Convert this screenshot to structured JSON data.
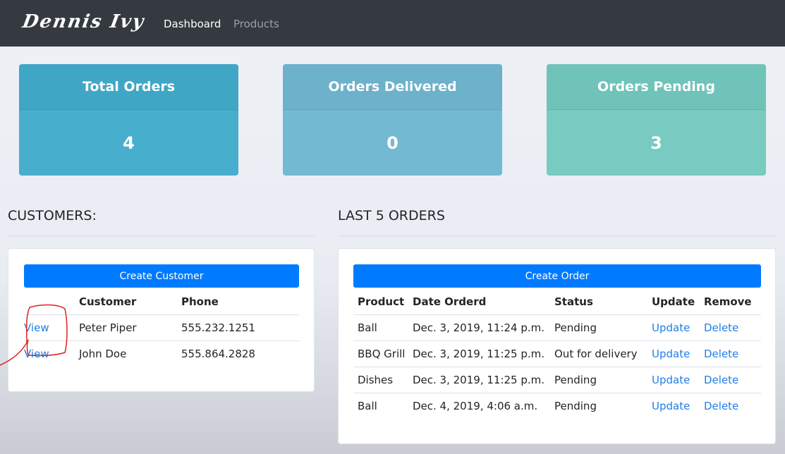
{
  "navbar": {
    "brand": "Dennis Ivy",
    "links": [
      "Dashboard",
      "Products"
    ]
  },
  "stats": [
    {
      "title": "Total Orders",
      "value": "4",
      "color": "#48aece"
    },
    {
      "title": "Orders Delivered",
      "value": "0",
      "color": "#74b9d2"
    },
    {
      "title": "Orders Pending",
      "value": "3",
      "color": "#79cac0"
    }
  ],
  "customers": {
    "section_title": "CUSTOMERS:",
    "create_label": "Create Customer",
    "headers": [
      "",
      "Customer",
      "Phone"
    ],
    "rows": [
      {
        "action": "View",
        "name": "Peter Piper",
        "phone": "555.232.1251"
      },
      {
        "action": "View",
        "name": "John Doe",
        "phone": "555.864.2828"
      }
    ]
  },
  "orders": {
    "section_title": "LAST 5 ORDERS",
    "create_label": "Create Order",
    "headers": [
      "Product",
      "Date Orderd",
      "Status",
      "Update",
      "Remove"
    ],
    "rows": [
      {
        "product": "Ball",
        "date": "Dec. 3, 2019, 11:24 p.m.",
        "status": "Pending",
        "update": "Update",
        "remove": "Delete"
      },
      {
        "product": "BBQ Grill",
        "date": "Dec. 3, 2019, 11:25 p.m.",
        "status": "Out for delivery",
        "update": "Update",
        "remove": "Delete"
      },
      {
        "product": "Dishes",
        "date": "Dec. 3, 2019, 11:25 p.m.",
        "status": "Pending",
        "update": "Update",
        "remove": "Delete"
      },
      {
        "product": "Ball",
        "date": "Dec. 4, 2019, 4:06 a.m.",
        "status": "Pending",
        "update": "Update",
        "remove": "Delete"
      }
    ]
  },
  "colors": {
    "navbar": "#343a40",
    "primary": "#007bff",
    "link": "#1f7fe6",
    "annotation": "#e02020"
  }
}
